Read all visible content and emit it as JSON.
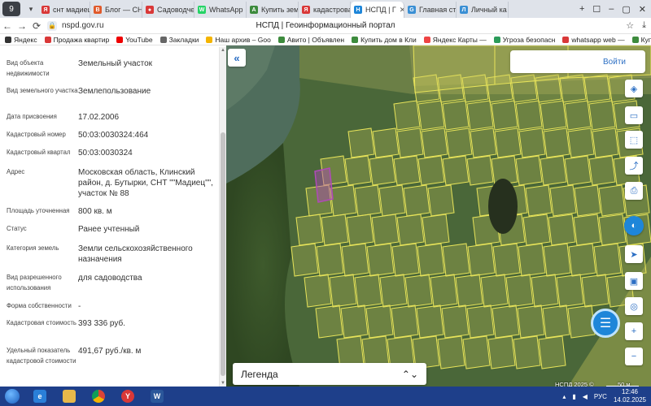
{
  "browser": {
    "tabs": [
      {
        "label": "снт мадиец",
        "color": "#d93838",
        "glyph": "Я"
      },
      {
        "label": "Блог — СНТ",
        "color": "#e05a2b",
        "glyph": "B"
      },
      {
        "label": "Садоводче",
        "color": "#d93838",
        "glyph": "●"
      },
      {
        "label": "WhatsApp",
        "color": "#25d366",
        "glyph": "W"
      },
      {
        "label": "Купить зем",
        "color": "#3d8b3d",
        "glyph": "A"
      },
      {
        "label": "кадастрова",
        "color": "#d93838",
        "glyph": "Я"
      },
      {
        "label": "НСПД | Г",
        "color": "#1e86d9",
        "glyph": "Н",
        "active": true
      },
      {
        "label": "Главная стр",
        "color": "#3a8fd4",
        "glyph": "G"
      },
      {
        "label": "Личный ка",
        "color": "#3a8fd4",
        "glyph": "Л"
      }
    ],
    "url": "nspd.gov.ru",
    "page_title": "НСПД | Геоинформационный портал",
    "bookmarks": [
      {
        "label": "Яндекс",
        "color": "#333"
      },
      {
        "label": "Продажа квартир",
        "color": "#d93838"
      },
      {
        "label": "YouTube",
        "color": "#e00"
      },
      {
        "label": "Закладки",
        "color": "#666"
      },
      {
        "label": "Наш архив – Goo",
        "color": "#f4b400"
      },
      {
        "label": "Авито | Объявлен",
        "color": "#3d8b3d"
      },
      {
        "label": "Купить дом в Кли",
        "color": "#3d8b3d"
      },
      {
        "label": "Яндекс Карты — ",
        "color": "#e44"
      },
      {
        "label": "Угроза безопасн",
        "color": "#2c9b5a"
      },
      {
        "label": "whatsapp web — ",
        "color": "#d93838"
      },
      {
        "label": "Купить дом, дачу",
        "color": "#3d8b3d"
      }
    ]
  },
  "info": {
    "rows": [
      {
        "label": "Вид объекта недвижимости",
        "value": "Земельный участок"
      },
      {
        "label": "Вид земельного участка",
        "value": "Землепользование"
      },
      {
        "label": "Дата присвоения",
        "value": "17.02.2006"
      },
      {
        "label": "Кадастровый номер",
        "value": "50:03:0030324:464"
      },
      {
        "label": "Кадастровый квартал",
        "value": "50:03:0030324"
      },
      {
        "label": "Адрес",
        "value": "Московская область, Клинский район, д. Бутырки, СНТ \"\"Мадиец\"\", участок № 88"
      },
      {
        "label": "Площадь уточненная",
        "value": "800 кв. м"
      },
      {
        "label": "Статус",
        "value": "Ранее учтенный"
      },
      {
        "label": "Категория земель",
        "value": "Земли сельскохозяйственного назначения"
      },
      {
        "label": "Вид разрешенного использования",
        "value": "для садоводства"
      },
      {
        "label": "Форма собственности",
        "value": "-"
      },
      {
        "label": "Кадастровая стоимость",
        "value": "393 336 руб."
      },
      {
        "label": "Удельный показатель кадастровой стоимости",
        "value": "491,67 руб./кв. м"
      }
    ]
  },
  "map": {
    "login_label": "Войти",
    "legend_label": "Легенда",
    "copyright": "НСПД 2025 ©",
    "scale": "50 м",
    "accent": "#1e86d9",
    "parcel_color": "#e8e45a",
    "selected_color": "#b04ab8"
  },
  "taskbar": {
    "lang": "РУС",
    "time": "12:46",
    "date": "14.02.2025"
  }
}
